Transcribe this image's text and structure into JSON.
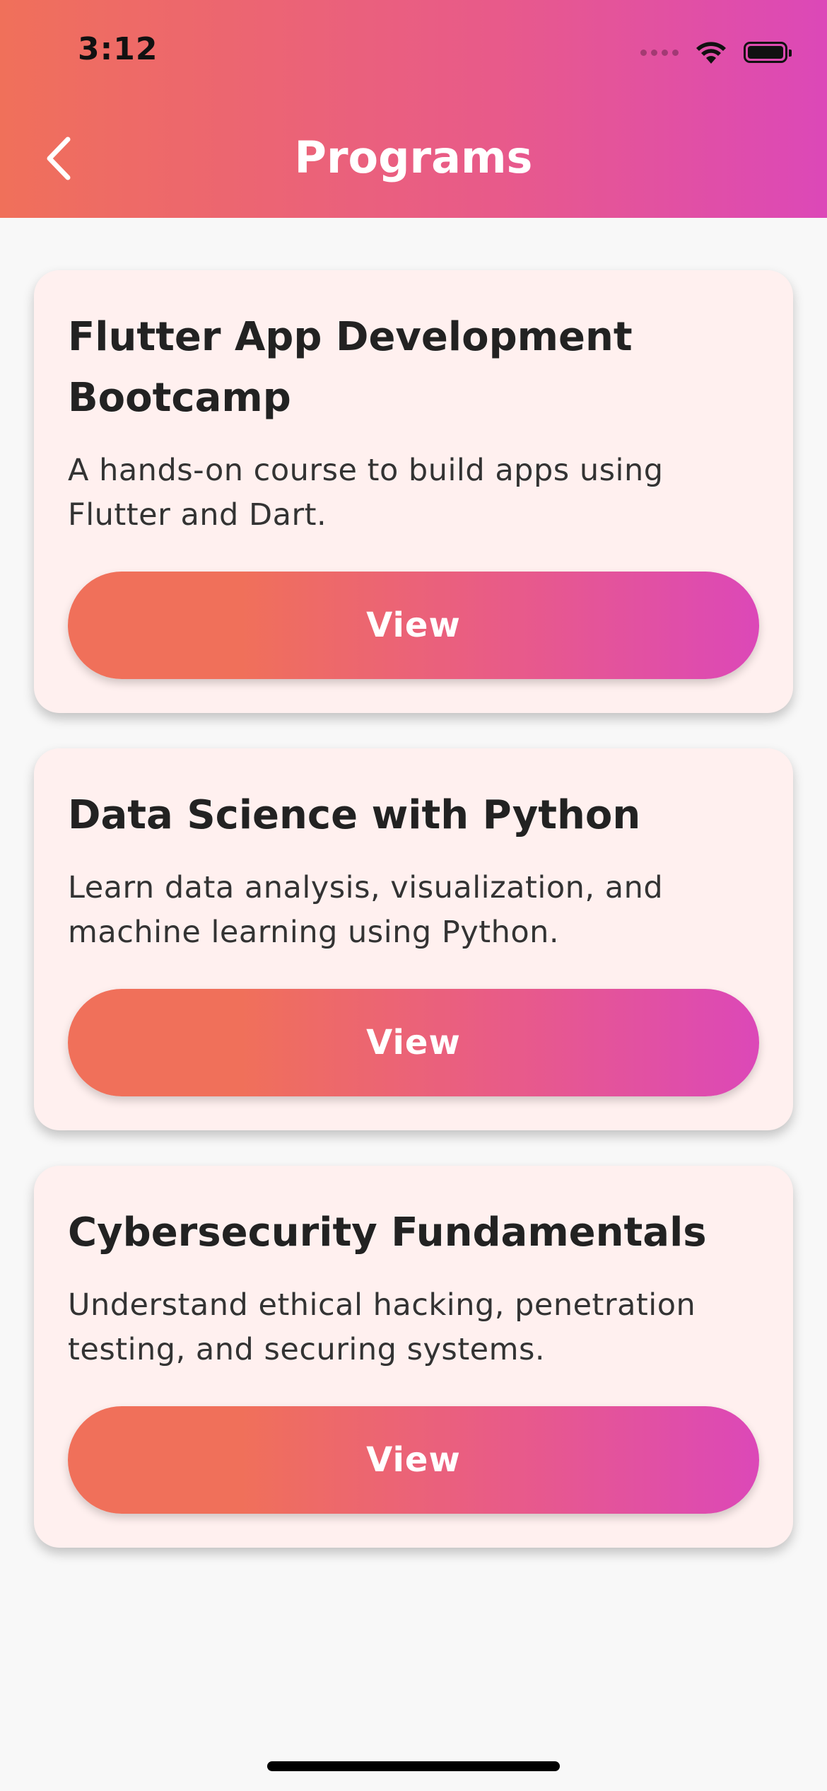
{
  "status_bar": {
    "time": "3:12",
    "icons": [
      "cellular-signal-icon",
      "wifi-icon",
      "battery-icon"
    ]
  },
  "header": {
    "title": "Programs",
    "back_icon": "chevron-left-icon"
  },
  "programs": [
    {
      "title": "Flutter App Development Bootcamp",
      "description": "A hands-on course to build apps using Flutter and Dart.",
      "button_label": "View"
    },
    {
      "title": "Data Science with Python",
      "description": "Learn data analysis, visualization, and machine learning using Python.",
      "button_label": "View"
    },
    {
      "title": "Cybersecurity Fundamentals",
      "description": "Understand ethical hacking, penetration testing, and securing systems.",
      "button_label": "View"
    }
  ],
  "colors": {
    "gradient_start": "#f0705a",
    "gradient_mid": "#e85a8a",
    "gradient_end": "#dc48b8",
    "card_background": "#fff0ef",
    "page_background": "#f8f8f8"
  }
}
